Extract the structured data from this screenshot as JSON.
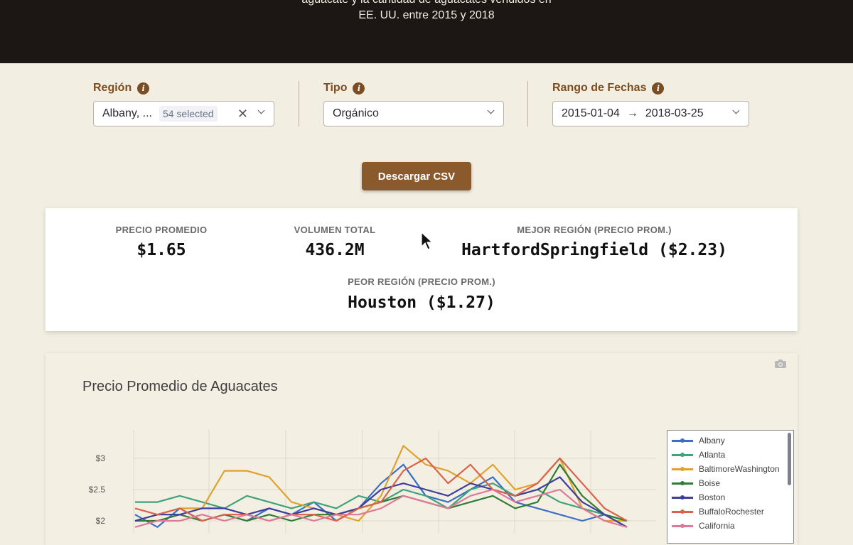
{
  "header": {
    "desc_line1": "aguacate y la cantidad de aguacates vendidos en",
    "desc_line2": "EE. UU. entre 2015 y 2018"
  },
  "filters": {
    "region": {
      "label": "Región",
      "value": "Albany, ...",
      "badge": "54 selected"
    },
    "tipo": {
      "label": "Tipo",
      "value": "Orgánico"
    },
    "fechas": {
      "label": "Rango de Fechas",
      "start": "2015-01-04",
      "arrow": "→",
      "end": "2018-03-25"
    }
  },
  "download_button": "Descargar CSV",
  "metrics": {
    "avg_price": {
      "label": "PRECIO PROMEDIO",
      "value": "$1.65"
    },
    "total_volume": {
      "label": "VOLUMEN TOTAL",
      "value": "436.2M"
    },
    "best_region": {
      "label": "MEJOR REGIÓN (PRECIO PROM.)",
      "value": "HartfordSpringfield ($2.23)"
    },
    "worst_region": {
      "label": "PEOR REGIÓN (PRECIO PROM.)",
      "value": "Houston ($1.27)"
    }
  },
  "chart_data": {
    "type": "line",
    "title": "Precio Promedio de Aguacates",
    "y_ticks": [
      "$3",
      "$2.5",
      "$2"
    ],
    "y_tick_values": [
      3,
      2.5,
      2
    ],
    "ylim": [
      1.8,
      3.6
    ],
    "grid": true,
    "legend_position": "right",
    "series": [
      {
        "name": "Albany",
        "color": "#3B6FC4",
        "values": [
          2.1,
          1.9,
          2.2,
          2.0,
          2.1,
          2.0,
          2.2,
          2.1,
          2.3,
          2.0,
          2.2,
          2.6,
          2.9,
          2.4,
          2.3,
          2.5,
          2.7,
          2.3,
          2.2,
          2.1,
          2.0,
          2.1,
          1.9
        ]
      },
      {
        "name": "Atlanta",
        "color": "#3FA27A",
        "values": [
          2.3,
          2.3,
          2.4,
          2.3,
          2.2,
          2.4,
          2.3,
          2.2,
          2.3,
          2.2,
          2.4,
          2.3,
          2.5,
          2.4,
          2.2,
          2.5,
          2.6,
          2.4,
          2.5,
          2.3,
          2.2,
          2.1,
          2.0
        ]
      },
      {
        "name": "BaltimoreWashington",
        "color": "#E0A22E",
        "values": [
          2.0,
          2.1,
          2.2,
          2.2,
          2.8,
          2.8,
          2.7,
          2.3,
          2.2,
          2.1,
          2.0,
          2.4,
          3.2,
          2.9,
          2.8,
          2.6,
          2.9,
          2.5,
          2.6,
          3.0,
          2.2,
          2.0,
          2.0
        ]
      },
      {
        "name": "Boise",
        "color": "#2E7D32",
        "values": [
          2.0,
          2.0,
          2.1,
          2.0,
          2.1,
          2.0,
          2.1,
          2.0,
          2.1,
          2.1,
          2.2,
          2.3,
          2.4,
          2.3,
          2.2,
          2.3,
          2.4,
          2.2,
          2.3,
          2.9,
          2.4,
          2.1,
          2.0
        ]
      },
      {
        "name": "Boston",
        "color": "#3E3D9E",
        "values": [
          2.0,
          2.1,
          2.1,
          2.2,
          2.2,
          2.1,
          2.2,
          2.1,
          2.2,
          2.1,
          2.2,
          2.5,
          2.6,
          2.5,
          2.4,
          2.6,
          2.5,
          2.4,
          2.5,
          2.7,
          2.3,
          2.1,
          1.9
        ]
      },
      {
        "name": "BuffaloRochester",
        "color": "#D9634A",
        "values": [
          2.2,
          2.1,
          2.2,
          2.0,
          2.1,
          2.1,
          2.0,
          2.1,
          2.1,
          2.0,
          2.2,
          2.3,
          2.8,
          3.0,
          2.6,
          2.9,
          2.5,
          2.4,
          2.6,
          3.0,
          2.6,
          2.2,
          2.0
        ]
      },
      {
        "name": "California",
        "color": "#E0789A",
        "values": [
          1.9,
          2.0,
          2.0,
          2.1,
          2.0,
          2.1,
          2.0,
          2.1,
          2.0,
          2.1,
          2.1,
          2.2,
          2.4,
          2.3,
          2.2,
          2.4,
          2.5,
          2.3,
          2.4,
          2.5,
          2.2,
          2.0,
          1.9
        ]
      }
    ]
  }
}
